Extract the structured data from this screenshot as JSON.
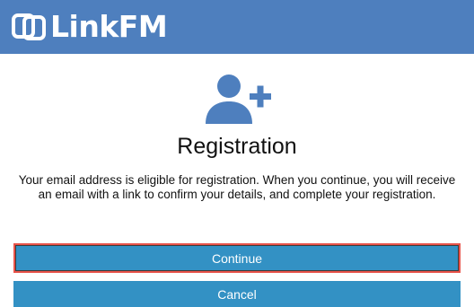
{
  "header": {
    "brand": "LinkFM",
    "logo_icon": "linked-squares-icon",
    "background": "#4e7fbe"
  },
  "main": {
    "icon": "user-add-icon",
    "title": "Registration",
    "message": "Your email address is eligible for registration. When you continue, you will receive an email with a link to confirm your details, and complete your registration."
  },
  "actions": {
    "continue_label": "Continue",
    "cancel_label": "Cancel",
    "button_color": "#3391c4",
    "focus_outline_color": "#e8534a"
  }
}
